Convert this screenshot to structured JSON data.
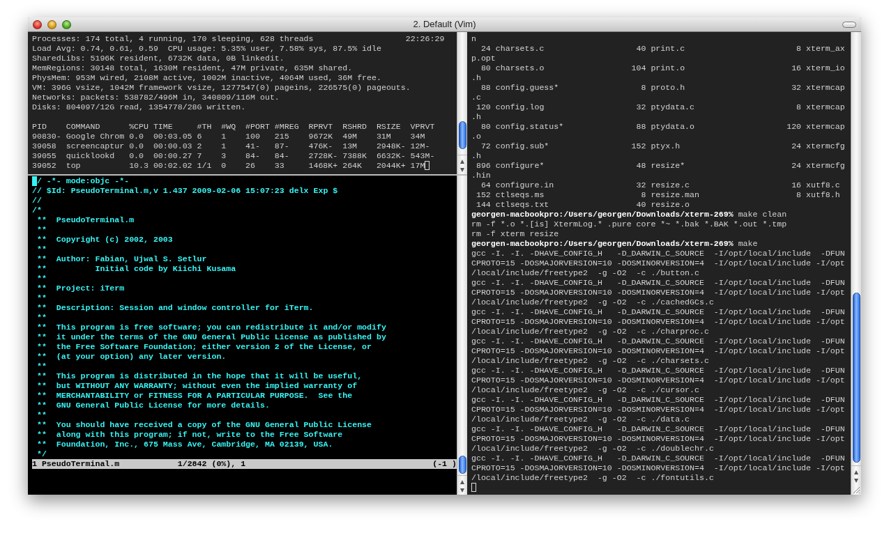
{
  "window": {
    "title": "2. Default (Vim)"
  },
  "top_pane": {
    "summary": [
      "Processes: 174 total, 4 running, 170 sleeping, 628 threads",
      "Load Avg: 0.74, 0.61, 0.59  CPU usage: 5.35% user, 7.58% sys, 87.5% idle",
      "SharedLibs: 5196K resident, 6732K data, 0B linkedit.",
      "MemRegions: 30148 total, 1630M resident, 47M private, 635M shared.",
      "PhysMem: 953M wired, 2108M active, 1002M inactive, 4064M used, 36M free.",
      "VM: 396G vsize, 1042M framework vsize, 1277547(0) pageins, 226575(0) pageouts.",
      "Networks: packets: 538782/496M in, 340809/116M out.",
      "Disks: 804097/12G read, 1354778/28G written."
    ],
    "clock": "22:26:29",
    "table": {
      "columns": [
        "PID",
        "COMMAND",
        "%CPU",
        "TIME",
        "#TH",
        "#WQ",
        "#PORT",
        "#MREG",
        "RPRVT",
        "RSHRD",
        "RSIZE",
        "VPRVT"
      ],
      "rows": [
        [
          "90830-",
          "Google Chrom",
          "0.0",
          "00:03.05",
          "6",
          "1",
          "100",
          "215",
          "9672K",
          "49M",
          "31M",
          "34M"
        ],
        [
          "39058",
          "screencaptur",
          "0.0",
          "00:00.03",
          "2",
          "1",
          "41-",
          "87-",
          "476K-",
          "13M",
          "2948K-",
          "12M-"
        ],
        [
          "39055",
          "quicklookd",
          "0.0",
          "00:00.27",
          "7",
          "3",
          "84-",
          "84-",
          "2728K-",
          "7388K",
          "6632K-",
          "543M-"
        ],
        [
          "39052",
          "top",
          "10.3",
          "00:02.02",
          "1/1",
          "0",
          "26",
          "33",
          "1468K+",
          "264K",
          "2044K+",
          "17M"
        ]
      ]
    }
  },
  "vim_pane": {
    "lines": [
      "// -*- mode:objc -*-",
      "// $Id: PseudoTerminal.m,v 1.437 2009-02-06 15:07:23 delx Exp $",
      "//",
      "/*",
      " **  PseudoTerminal.m",
      " **",
      " **  Copyright (c) 2002, 2003",
      " **",
      " **  Author: Fabian, Ujwal S. Setlur",
      " **          Initial code by Kiichi Kusama",
      " **",
      " **  Project: iTerm",
      " **",
      " **  Description: Session and window controller for iTerm.",
      " **",
      " **  This program is free software; you can redistribute it and/or modify",
      " **  it under the terms of the GNU General Public License as published by",
      " **  the Free Software Foundation; either version 2 of the License, or",
      " **  (at your option) any later version.",
      " **",
      " **  This program is distributed in the hope that it will be useful,",
      " **  but WITHOUT ANY WARRANTY; without even the implied warranty of",
      " **  MERCHANTABILITY or FITNESS FOR A PARTICULAR PURPOSE.  See the",
      " **  GNU General Public License for more details.",
      " **",
      " **  You should have received a copy of the GNU General Public License",
      " **  along with this program; if not, write to the Free Software",
      " **  Foundation, Inc., 675 Mass Ave, Cambridge, MA 02139, USA.",
      " */"
    ],
    "status": {
      "buffer": "1 PseudoTerminal.m",
      "position": "1/2842 (0%), 1",
      "info": "(-1 )"
    }
  },
  "shell_pane": {
    "lines": [
      {
        "kind": "text",
        "text": "n"
      },
      {
        "kind": "listing",
        "cells": [
          "24",
          "charsets.c",
          "40",
          "print.c",
          "8",
          "xterm_ax"
        ]
      },
      {
        "kind": "text",
        "text": "p.opt"
      },
      {
        "kind": "listing",
        "cells": [
          "80",
          "charsets.o",
          "104",
          "print.o",
          "16",
          "xterm_io"
        ]
      },
      {
        "kind": "text",
        "text": ".h"
      },
      {
        "kind": "listing",
        "cells": [
          "88",
          "config.guess*",
          "8",
          "proto.h",
          "32",
          "xtermcap"
        ]
      },
      {
        "kind": "text",
        "text": ".c"
      },
      {
        "kind": "listing",
        "cells": [
          "120",
          "config.log",
          "32",
          "ptydata.c",
          "8",
          "xtermcap"
        ]
      },
      {
        "kind": "text",
        "text": ".h"
      },
      {
        "kind": "listing",
        "cells": [
          "80",
          "config.status*",
          "88",
          "ptydata.o",
          "120",
          "xtermcap"
        ]
      },
      {
        "kind": "text",
        "text": ".o"
      },
      {
        "kind": "listing",
        "cells": [
          "72",
          "config.sub*",
          "152",
          "ptyx.h",
          "24",
          "xtermcfg"
        ]
      },
      {
        "kind": "text",
        "text": ".h"
      },
      {
        "kind": "listing",
        "cells": [
          "896",
          "configure*",
          "48",
          "resize*",
          "24",
          "xtermcfg"
        ]
      },
      {
        "kind": "text",
        "text": ".hin"
      },
      {
        "kind": "listing",
        "cells": [
          "64",
          "configure.in",
          "32",
          "resize.c",
          "16",
          "xutf8.c"
        ]
      },
      {
        "kind": "listing",
        "cells": [
          "152",
          "ctlseqs.ms",
          "8",
          "resize.man",
          "8",
          "xutf8.h"
        ]
      },
      {
        "kind": "listing",
        "cells": [
          "144",
          "ctlseqs.txt",
          "40",
          "resize.o"
        ]
      },
      {
        "kind": "prompt",
        "prompt": "georgen-macbookpro:/Users/georgen/Downloads/xterm-269%",
        "command": "make clean"
      },
      {
        "kind": "text",
        "text": "rm -f *.o *.[is] XtermLog.* .pure core *~ *.bak *.BAK *.out *.tmp"
      },
      {
        "kind": "text",
        "text": "rm -f xterm resize"
      },
      {
        "kind": "prompt",
        "prompt": "georgen-macbookpro:/Users/georgen/Downloads/xterm-269%",
        "command": "make"
      },
      {
        "kind": "text",
        "text": "gcc -I. -I. -DHAVE_CONFIG_H   -D_DARWIN_C_SOURCE  -I/opt/local/include  -DFUN"
      },
      {
        "kind": "text",
        "text": "CPROTO=15 -DOSMAJORVERSION=10 -DOSMINORVERSION=4  -I/opt/local/include -I/opt"
      },
      {
        "kind": "text",
        "text": "/local/include/freetype2  -g -O2  -c ./button.c"
      },
      {
        "kind": "text",
        "text": "gcc -I. -I. -DHAVE_CONFIG_H   -D_DARWIN_C_SOURCE  -I/opt/local/include  -DFUN"
      },
      {
        "kind": "text",
        "text": "CPROTO=15 -DOSMAJORVERSION=10 -DOSMINORVERSION=4  -I/opt/local/include -I/opt"
      },
      {
        "kind": "text",
        "text": "/local/include/freetype2  -g -O2  -c ./cachedGCs.c"
      },
      {
        "kind": "text",
        "text": "gcc -I. -I. -DHAVE_CONFIG_H   -D_DARWIN_C_SOURCE  -I/opt/local/include  -DFUN"
      },
      {
        "kind": "text",
        "text": "CPROTO=15 -DOSMAJORVERSION=10 -DOSMINORVERSION=4  -I/opt/local/include -I/opt"
      },
      {
        "kind": "text",
        "text": "/local/include/freetype2  -g -O2  -c ./charproc.c"
      },
      {
        "kind": "text",
        "text": "gcc -I. -I. -DHAVE_CONFIG_H   -D_DARWIN_C_SOURCE  -I/opt/local/include  -DFUN"
      },
      {
        "kind": "text",
        "text": "CPROTO=15 -DOSMAJORVERSION=10 -DOSMINORVERSION=4  -I/opt/local/include -I/opt"
      },
      {
        "kind": "text",
        "text": "/local/include/freetype2  -g -O2  -c ./charsets.c"
      },
      {
        "kind": "text",
        "text": "gcc -I. -I. -DHAVE_CONFIG_H   -D_DARWIN_C_SOURCE  -I/opt/local/include  -DFUN"
      },
      {
        "kind": "text",
        "text": "CPROTO=15 -DOSMAJORVERSION=10 -DOSMINORVERSION=4  -I/opt/local/include -I/opt"
      },
      {
        "kind": "text",
        "text": "/local/include/freetype2  -g -O2  -c ./cursor.c"
      },
      {
        "kind": "text",
        "text": "gcc -I. -I. -DHAVE_CONFIG_H   -D_DARWIN_C_SOURCE  -I/opt/local/include  -DFUN"
      },
      {
        "kind": "text",
        "text": "CPROTO=15 -DOSMAJORVERSION=10 -DOSMINORVERSION=4  -I/opt/local/include -I/opt"
      },
      {
        "kind": "text",
        "text": "/local/include/freetype2  -g -O2  -c ./data.c"
      },
      {
        "kind": "text",
        "text": "gcc -I. -I. -DHAVE_CONFIG_H   -D_DARWIN_C_SOURCE  -I/opt/local/include  -DFUN"
      },
      {
        "kind": "text",
        "text": "CPROTO=15 -DOSMAJORVERSION=10 -DOSMINORVERSION=4  -I/opt/local/include -I/opt"
      },
      {
        "kind": "text",
        "text": "/local/include/freetype2  -g -O2  -c ./doublechr.c"
      },
      {
        "kind": "text",
        "text": "gcc -I. -I. -DHAVE_CONFIG_H   -D_DARWIN_C_SOURCE  -I/opt/local/include  -DFUN"
      },
      {
        "kind": "text",
        "text": "CPROTO=15 -DOSMAJORVERSION=10 -DOSMINORVERSION=4  -I/opt/local/include -I/opt"
      },
      {
        "kind": "text",
        "text": "/local/include/freetype2  -g -O2  -c ./fontutils.c"
      },
      {
        "kind": "cursor"
      }
    ]
  }
}
